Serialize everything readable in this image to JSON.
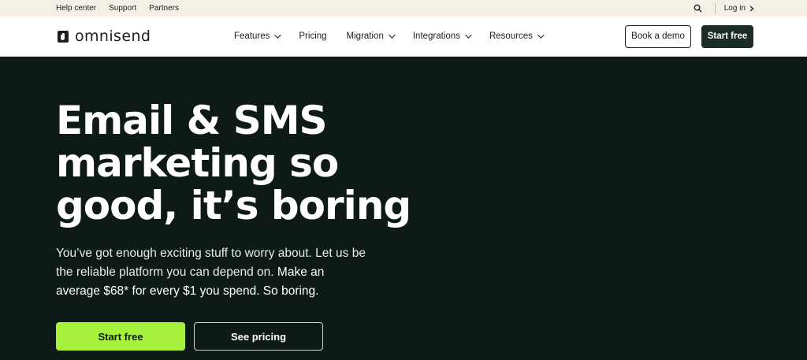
{
  "utility_bar": {
    "links": [
      "Help center",
      "Support",
      "Partners"
    ],
    "search_icon": "search-icon",
    "login_label": "Log in"
  },
  "nav": {
    "logo_text": "omnisend",
    "menu": [
      {
        "label": "Features",
        "dropdown": true
      },
      {
        "label": "Pricing",
        "dropdown": false
      },
      {
        "label": "Migration",
        "dropdown": true
      },
      {
        "label": "Integrations",
        "dropdown": true
      },
      {
        "label": "Resources",
        "dropdown": true
      }
    ],
    "book_demo_label": "Book a demo",
    "start_free_label": "Start free"
  },
  "hero": {
    "headline_line1": "Email & SMS",
    "headline_line2": "marketing so",
    "headline_line3": "good, it’s boring",
    "sub_part1": "You’ve got enough exciting stuff to worry about. Let us be the reliable platform you can depend on.",
    "sub_part2": "Make an average $68* for every $1 you spend. So boring.",
    "cta_primary": "Start free",
    "cta_secondary": "See pricing"
  },
  "colors": {
    "hero_bg": "#0e1a18",
    "accent_green": "#a5f13d",
    "utility_bg": "#f4f0e6"
  }
}
